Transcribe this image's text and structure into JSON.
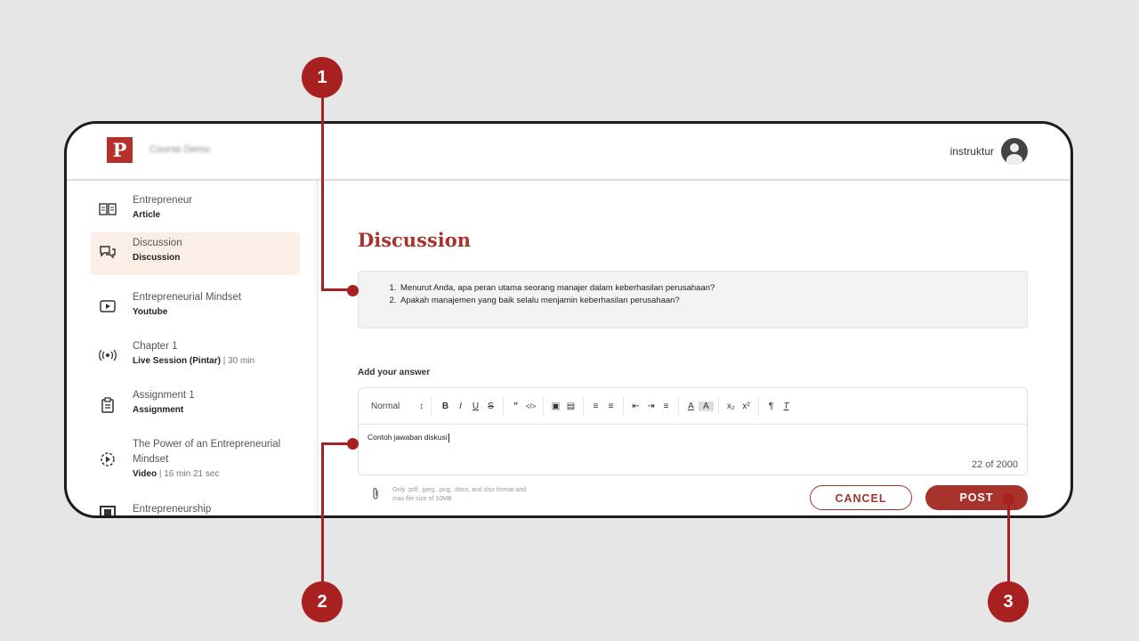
{
  "header": {
    "logo_letter": "P",
    "course_title": "Course Demo",
    "user_name": "instruktur"
  },
  "sidebar": {
    "items": [
      {
        "title": "Entrepreneur",
        "type": "Article",
        "extra": "",
        "icon": "book-open-icon"
      },
      {
        "title": "Discussion",
        "type": "Discussion",
        "extra": "",
        "icon": "chat-bubbles-icon"
      },
      {
        "title": "Entrepreneurial Mindset",
        "type": "Youtube",
        "extra": "",
        "icon": "play-video-icon"
      },
      {
        "title": "Chapter 1",
        "type": "Live Session (Pintar)",
        "extra": " | 30 min",
        "icon": "live-broadcast-icon"
      },
      {
        "title": "Assignment 1",
        "type": "Assignment",
        "extra": "",
        "icon": "clipboard-icon"
      },
      {
        "title": "The Power of an Entrepreneurial Mindset",
        "type": "Video",
        "extra": " | 16 min 21 sec",
        "icon": "play-circle-icon"
      },
      {
        "title": "Entrepreneurship",
        "type": "",
        "extra": "",
        "icon": "slides-icon"
      }
    ]
  },
  "main": {
    "title": "Discussion",
    "questions": [
      "Menurut Anda, apa peran utama seorang manajer dalam keberhasilan perusahaan?",
      "Apakah manajemen yang baik selalu menjamin keberhasilan perusahaan?"
    ],
    "answer_label": "Add your answer",
    "editor": {
      "format_select": "Normal",
      "content": "Contoh jawaban diskusi",
      "counter": "22 of 2000"
    },
    "attachment_hint_line1": "Only .pdf, .jpeg, .png, .docx, and xlsx format and",
    "attachment_hint_line2": "max file size of 10MB",
    "cancel_label": "CANCEL",
    "post_label": "POST"
  },
  "annotations": [
    "1",
    "2",
    "3"
  ],
  "colors": {
    "accent": "#a8322c",
    "annotation": "#a8201f",
    "active_bg": "#fbeee6",
    "page_bg": "#e6e6e6"
  }
}
